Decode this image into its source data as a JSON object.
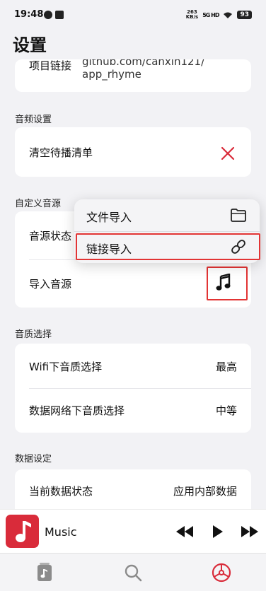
{
  "status_bar": {
    "time": "19:48",
    "net_speed_value": "263",
    "net_speed_unit": "KB/s",
    "network_type": "5G HD",
    "battery": "93"
  },
  "page": {
    "title": "设置"
  },
  "project": {
    "label": "项目链接",
    "value_line1": "github.com/canxin121/",
    "value_line2": "app_rhyme"
  },
  "audio_settings": {
    "section_label": "音频设置",
    "clear_queue_label": "清空待播清单"
  },
  "custom_source": {
    "section_label": "自定义音源",
    "status_label": "音源状态",
    "import_label": "导入音源"
  },
  "popup_menu": {
    "items": [
      {
        "label": "文件导入",
        "icon": "folder-icon"
      },
      {
        "label": "链接导入",
        "icon": "link-icon"
      }
    ]
  },
  "quality": {
    "section_label": "音质选择",
    "rows": [
      {
        "label": "Wifi下音质选择",
        "value": "最高"
      },
      {
        "label": "数据网络下音质选择",
        "value": "中等"
      }
    ]
  },
  "data_settings": {
    "section_label": "数据设定",
    "rows": [
      {
        "label": "当前数据状态",
        "value": "应用内部数据"
      }
    ]
  },
  "player": {
    "title": "Music"
  },
  "colors": {
    "accent_red": "#d92b3a",
    "highlight_red": "#e23434",
    "background": "#f2f2f5"
  }
}
